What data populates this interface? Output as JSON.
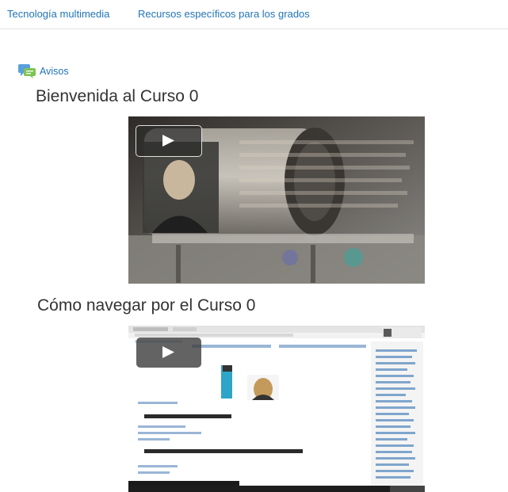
{
  "nav": {
    "link1": "Tecnología multimedia",
    "link2": "Recursos específicos para los grados"
  },
  "forum": {
    "label": "Avisos",
    "icon": "forum-icon"
  },
  "sections": [
    {
      "title": "Bienvenida al Curso 0"
    },
    {
      "title": "Cómo navegar por el Curso 0"
    }
  ],
  "colors": {
    "link": "#1f74b8",
    "text": "#333333"
  }
}
